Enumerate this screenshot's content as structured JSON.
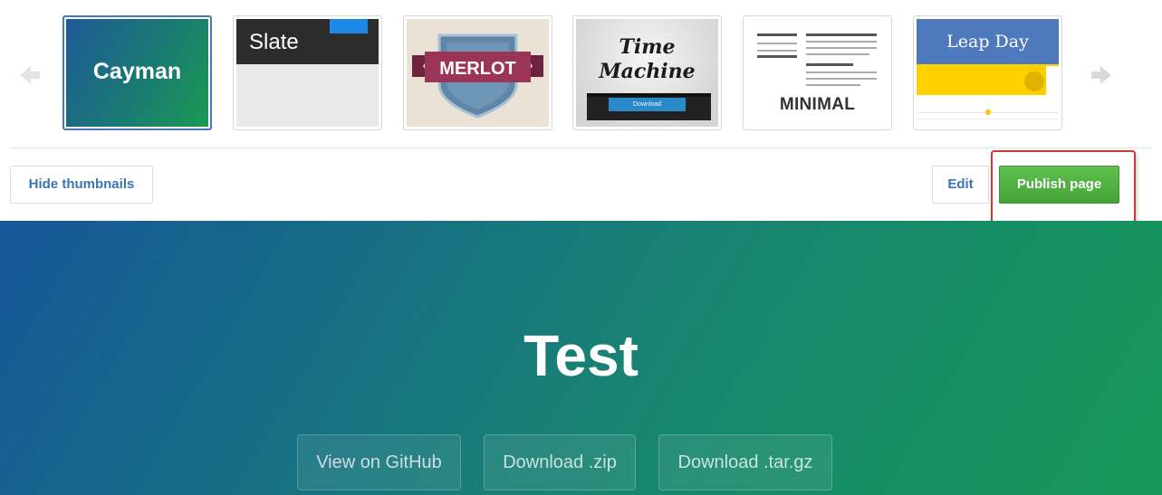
{
  "themes": [
    {
      "name": "Cayman",
      "label": "Cayman",
      "selected": true
    },
    {
      "name": "Slate",
      "label": "Slate",
      "selected": false
    },
    {
      "name": "Merlot",
      "label": "MERLOT",
      "selected": false
    },
    {
      "name": "Time Machine",
      "label_line1": "Time",
      "label_line2": "Machine",
      "button": "Download",
      "selected": false
    },
    {
      "name": "Minimal",
      "label": "MINIMAL",
      "selected": false
    },
    {
      "name": "Leap Day",
      "label": "Leap Day",
      "selected": false
    }
  ],
  "icons": {
    "prev": "arrow-left-icon",
    "next": "arrow-right-icon"
  },
  "toolbar": {
    "hide_thumbnails": "Hide thumbnails",
    "edit": "Edit",
    "publish": "Publish page"
  },
  "hero": {
    "title": "Test",
    "buttons": [
      "View on GitHub",
      "Download .zip",
      "Download .tar.gz"
    ]
  },
  "colors": {
    "link": "#3a74b3",
    "publish_green": "#4eae3f",
    "highlight_red": "#c63a3a",
    "hero_start": "#155799",
    "hero_end": "#159957"
  }
}
